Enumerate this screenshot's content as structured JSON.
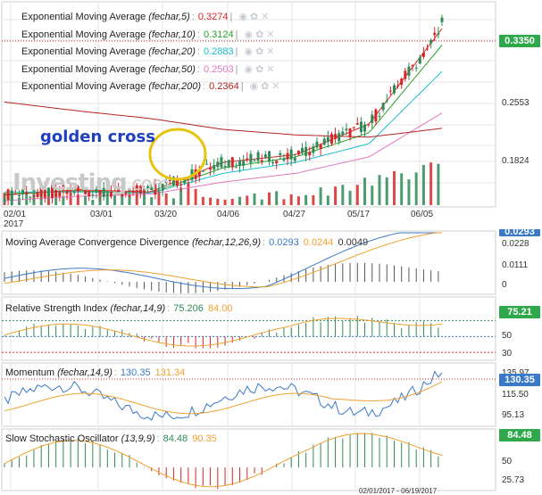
{
  "price_panel": {
    "legend": [
      {
        "name": "Exponential Moving Average",
        "params": "(fechar,5)",
        "value": "0.3274",
        "color": "#d62728"
      },
      {
        "name": "Exponential Moving Average",
        "params": "(fechar,10)",
        "value": "0.3124",
        "color": "#2ca02c"
      },
      {
        "name": "Exponential Moving Average",
        "params": "(fechar,20)",
        "value": "0.2883",
        "color": "#17becf"
      },
      {
        "name": "Exponential Moving Average",
        "params": "(fechar,50)",
        "value": "0.2503",
        "color": "#e377c2"
      },
      {
        "name": "Exponential Moving Average",
        "params": "(fechar,200)",
        "value": "0.2364",
        "color": "#b22222"
      }
    ],
    "price_badge": "0.3350",
    "y_ticks": [
      "0.2553",
      "0.1824"
    ],
    "annotation": "golden cross",
    "logo_main": "Investing",
    "logo_suffix": ".com"
  },
  "x_ticks": [
    "02/01",
    "03/01",
    "03/20",
    "04/06",
    "04/27",
    "05/17",
    "06/05"
  ],
  "x_year": "2017",
  "macd_panel": {
    "name": "Moving Average Convergence Divergence",
    "params": "(fechar,12,26,9)",
    "values": [
      "0.0293",
      "0.0244",
      "0.0049"
    ],
    "badge": "0.0293",
    "y_ticks": [
      "0.0228",
      "0.0111",
      "0"
    ]
  },
  "rsi_panel": {
    "name": "Relative Strength Index",
    "params": "(fechar,14,9)",
    "values": [
      "75.206",
      "84.00"
    ],
    "badge": "75.21",
    "y_ticks": [
      "50",
      "30"
    ]
  },
  "mom_panel": {
    "name": "Momentum",
    "params": "(fechar,14,9)",
    "values": [
      "130.35",
      "131.34"
    ],
    "badge": "130.35",
    "y_ticks": [
      "135.97",
      "115.50",
      "95.13"
    ]
  },
  "stoch_panel": {
    "name": "Slow Stochastic Oscillator",
    "params": "(13,9,9)",
    "values": [
      "84.48",
      "90.35"
    ],
    "badge": "84.48",
    "y_ticks": [
      "50",
      "25.73"
    ]
  },
  "date_range": "02/01/2017 - 06/19/2017",
  "chart_data": {
    "type": "line",
    "x": [
      "02/01",
      "03/01",
      "03/20",
      "04/06",
      "04/27",
      "05/17",
      "06/05"
    ],
    "series": [
      {
        "name": "EMA(fechar,5)",
        "values": [
          0.175,
          0.18,
          0.178,
          0.205,
          0.212,
          0.24,
          0.327
        ]
      },
      {
        "name": "EMA(fechar,10)",
        "values": [
          0.176,
          0.179,
          0.177,
          0.2,
          0.21,
          0.232,
          0.312
        ]
      },
      {
        "name": "EMA(fechar,20)",
        "values": [
          0.178,
          0.178,
          0.177,
          0.195,
          0.205,
          0.222,
          0.288
        ]
      },
      {
        "name": "EMA(fechar,50)",
        "values": [
          0.17,
          0.174,
          0.176,
          0.187,
          0.195,
          0.21,
          0.25
        ]
      },
      {
        "name": "EMA(fechar,200)",
        "values": [
          0.26,
          0.252,
          0.245,
          0.235,
          0.23,
          0.228,
          0.236
        ]
      }
    ],
    "last_price": 0.335,
    "ylim": [
      0.17,
      0.345
    ],
    "macd": [
      0.0293,
      0.0244,
      0.0049
    ],
    "rsi": [
      75.206,
      84.0
    ],
    "momentum": [
      130.35,
      131.34
    ],
    "stochastic": [
      84.48,
      90.35
    ]
  },
  "colors": {
    "up": "#2e8b57",
    "down": "#d62728",
    "grid": "#e6e6e6",
    "badge": "#2ea84a",
    "badge_blue": "#3a78c8"
  }
}
